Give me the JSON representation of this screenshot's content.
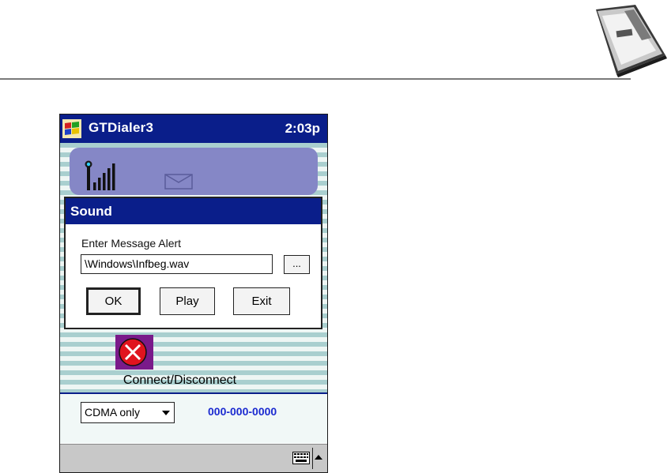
{
  "window": {
    "app_title": "GTDialer3",
    "clock": "2:03p"
  },
  "dialog": {
    "title": "Sound",
    "label": "Enter Message Alert",
    "path_value": "\\Windows\\Infbeg.wav",
    "browse_label": "...",
    "ok_label": "OK",
    "play_label": "Play",
    "exit_label": "Exit"
  },
  "main": {
    "connect_label": "Connect/Disconnect",
    "mode_selected": "CDMA only",
    "phone_number": "000-000-0000"
  },
  "icons": {
    "start": "windows-start-icon",
    "signal": "signal-strength-icon",
    "message": "envelope-icon",
    "connect": "disconnect-x-icon",
    "keyboard": "keyboard-icon",
    "sip_toggle": "up-arrow-icon",
    "card": "pc-card-image"
  },
  "colors": {
    "titlebar": "#0a1e8a",
    "panel": "#8587c6",
    "stripe": "#a9cfcf",
    "phone_text": "#1b2ad0",
    "connect_red": "#e0141e",
    "connect_bg": "#7a1a8a"
  }
}
